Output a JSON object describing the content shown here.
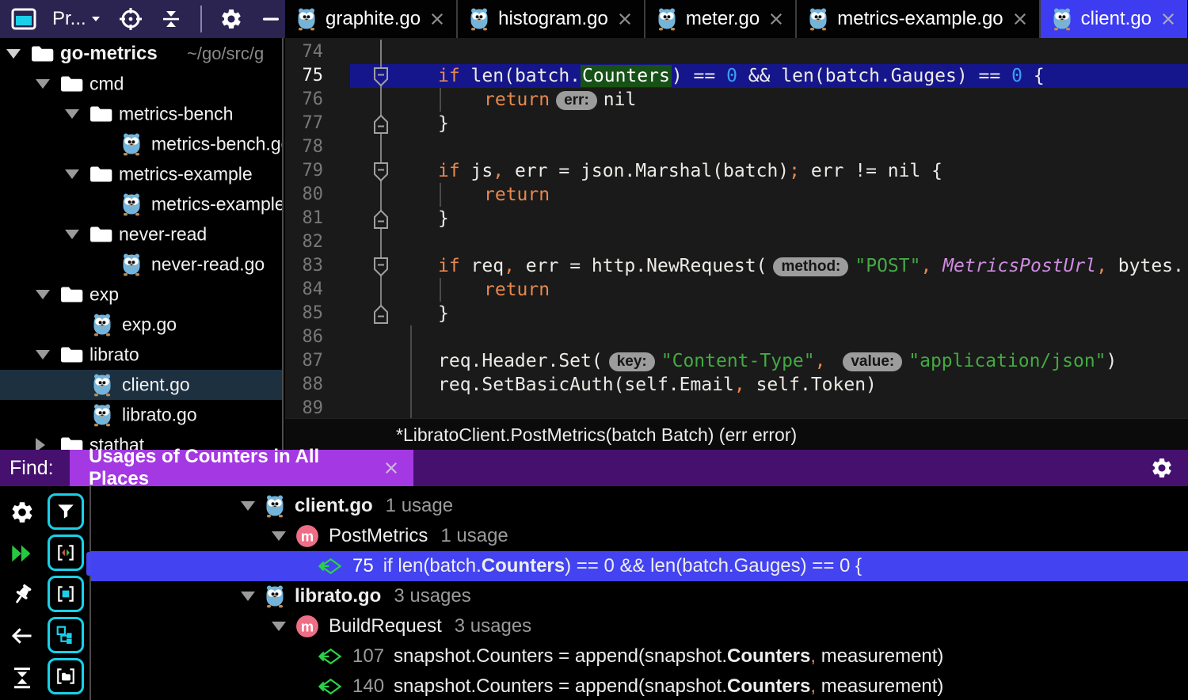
{
  "toolbar": {
    "project_label": "Pr...",
    "buttons": [
      {
        "name": "tool-window-button",
        "icon": "tool-window-icon"
      },
      {
        "name": "project-selector",
        "icon": "chevron-down-icon",
        "has_label": true
      },
      {
        "name": "locate-button",
        "icon": "target-icon"
      },
      {
        "name": "collapse-button",
        "icon": "collapse-icon"
      },
      {
        "name": "divider"
      },
      {
        "name": "settings-button",
        "icon": "gear-icon"
      },
      {
        "name": "hide-button",
        "icon": "minus-icon"
      }
    ]
  },
  "tabs": {
    "items": [
      {
        "label": "graphite.go"
      },
      {
        "label": "histogram.go"
      },
      {
        "label": "meter.go"
      },
      {
        "label": "metrics-example.go"
      },
      {
        "label": "client.go",
        "active": true
      }
    ]
  },
  "project_tree": {
    "items": [
      {
        "label": "go-metrics",
        "suffix": "~/go/src/g",
        "type": "folder",
        "depth": 0,
        "arrow": "down",
        "bold": true
      },
      {
        "label": "cmd",
        "type": "folder",
        "depth": 1,
        "arrow": "down"
      },
      {
        "label": "metrics-bench",
        "type": "folder",
        "depth": 2,
        "arrow": "down"
      },
      {
        "label": "metrics-bench.go",
        "type": "go-file",
        "depth": 3
      },
      {
        "label": "metrics-example",
        "type": "folder",
        "depth": 2,
        "arrow": "down"
      },
      {
        "label": "metrics-example.go",
        "type": "go-file",
        "depth": 3
      },
      {
        "label": "never-read",
        "type": "folder",
        "depth": 2,
        "arrow": "down"
      },
      {
        "label": "never-read.go",
        "type": "go-file",
        "depth": 3
      },
      {
        "label": "exp",
        "type": "folder",
        "depth": 1,
        "arrow": "down"
      },
      {
        "label": "exp.go",
        "type": "go-file",
        "depth": 2
      },
      {
        "label": "librato",
        "type": "folder",
        "depth": 1,
        "arrow": "down"
      },
      {
        "label": "client.go",
        "type": "go-file",
        "depth": 2,
        "selected": true
      },
      {
        "label": "librato.go",
        "type": "go-file",
        "depth": 2
      },
      {
        "label": "stathat",
        "type": "folder",
        "depth": 1,
        "arrow": "right"
      }
    ]
  },
  "editor": {
    "breadcrumb": "*LibratoClient.PostMetrics(batch Batch) (err error)",
    "lines": [
      {
        "num": 74,
        "ind": 0,
        "tok": []
      },
      {
        "num": 75,
        "ind": 1,
        "current": true,
        "fold": "start",
        "tok": [
          [
            "k",
            "if"
          ],
          [
            "p",
            " len(batch."
          ],
          [
            "m",
            "Counters"
          ],
          [
            "p",
            ") == "
          ],
          [
            "n",
            "0"
          ],
          [
            "p",
            " && len(batch.Gauges) == "
          ],
          [
            "n",
            "0"
          ],
          [
            "p",
            " {"
          ]
        ]
      },
      {
        "num": 76,
        "ind": 2,
        "guide": true,
        "tok": [
          [
            "k",
            "return"
          ],
          [
            "i",
            "err:"
          ],
          [
            "p",
            "nil"
          ]
        ]
      },
      {
        "num": 77,
        "ind": 1,
        "fold": "end",
        "tok": [
          [
            "p",
            "}"
          ]
        ]
      },
      {
        "num": 78,
        "ind": 0,
        "tok": []
      },
      {
        "num": 79,
        "ind": 1,
        "fold": "start",
        "tok": [
          [
            "k",
            "if"
          ],
          [
            "p",
            " js"
          ],
          [
            "o",
            ","
          ],
          [
            "p",
            " err = json.Marshal(batch)"
          ],
          [
            "o",
            ";"
          ],
          [
            "p",
            " err != nil {"
          ]
        ]
      },
      {
        "num": 80,
        "ind": 2,
        "guide": true,
        "tok": [
          [
            "k",
            "return"
          ]
        ]
      },
      {
        "num": 81,
        "ind": 1,
        "fold": "end",
        "tok": [
          [
            "p",
            "}"
          ]
        ]
      },
      {
        "num": 82,
        "ind": 0,
        "tok": []
      },
      {
        "num": 83,
        "ind": 1,
        "fold": "start",
        "tok": [
          [
            "k",
            "if"
          ],
          [
            "p",
            " req"
          ],
          [
            "o",
            ","
          ],
          [
            "p",
            " err = http.NewRequest("
          ],
          [
            "i",
            "method:"
          ],
          [
            "s",
            "\"POST\""
          ],
          [
            "o",
            ","
          ],
          [
            "p",
            " "
          ],
          [
            "t",
            "MetricsPostUrl"
          ],
          [
            "o",
            ","
          ],
          [
            "p",
            " bytes."
          ]
        ]
      },
      {
        "num": 84,
        "ind": 2,
        "guide": true,
        "tok": [
          [
            "k",
            "return"
          ]
        ]
      },
      {
        "num": 85,
        "ind": 1,
        "fold": "end",
        "tok": [
          [
            "p",
            "}"
          ]
        ]
      },
      {
        "num": 86,
        "ind": 0,
        "tok": []
      },
      {
        "num": 87,
        "ind": 1,
        "tok": [
          [
            "p",
            "req.Header.Set("
          ],
          [
            "i",
            "key:"
          ],
          [
            "s",
            "\"Content-Type\""
          ],
          [
            "o",
            ","
          ],
          [
            "p",
            " "
          ],
          [
            "i",
            "value:"
          ],
          [
            "s",
            "\"application/json\""
          ],
          [
            "p",
            ")"
          ]
        ]
      },
      {
        "num": 88,
        "ind": 1,
        "tok": [
          [
            "p",
            "req.SetBasicAuth(self.Email"
          ],
          [
            "o",
            ","
          ],
          [
            "p",
            " self.Token)"
          ]
        ]
      },
      {
        "num": 89,
        "ind": 0,
        "tok": []
      }
    ]
  },
  "find_bar": {
    "label": "Find:",
    "tab_title": "Usages of Counters in All Places"
  },
  "find_panel": {
    "toolbar_left": [
      "settings-icon",
      "rerun-icon",
      "pin-icon",
      "back-arrow-icon",
      "collapse-expand-icon"
    ],
    "toolbar_toggles": [
      "filter-icon",
      "read-write-access-icon",
      "preview-square-icon",
      "group-by-icon",
      "open-in-window-icon"
    ],
    "results": [
      {
        "kind": "file",
        "depth": 0,
        "label": "client.go",
        "count": "1 usage"
      },
      {
        "kind": "method",
        "depth": 1,
        "label": "PostMetrics",
        "count": "1 usage"
      },
      {
        "kind": "usage",
        "depth": 2,
        "line": "75",
        "selected": true,
        "segments": [
          {
            "text": "if len(batch."
          },
          {
            "text": "Counters",
            "bold": true
          },
          {
            "text": ") == 0 && len(batch.Gauges) == 0 {"
          }
        ]
      },
      {
        "kind": "file",
        "depth": 0,
        "label": "librato.go",
        "count": "3 usages"
      },
      {
        "kind": "method",
        "depth": 1,
        "label": "BuildRequest",
        "count": "3 usages"
      },
      {
        "kind": "usage",
        "depth": 2,
        "line": "107",
        "segments": [
          {
            "text": "snapshot.Counters = append(snapshot."
          },
          {
            "text": "Counters",
            "bold": true
          },
          {
            "text": ",",
            "orange": true
          },
          {
            "text": " measurement)"
          }
        ]
      },
      {
        "kind": "usage",
        "depth": 2,
        "line": "140",
        "segments": [
          {
            "text": "snapshot.Counters = append(snapshot."
          },
          {
            "text": "Counters",
            "bold": true
          },
          {
            "text": ",",
            "orange": true
          },
          {
            "text": " measurement)"
          }
        ]
      }
    ]
  },
  "colors": {
    "toolbar_purple": "#2b2350",
    "accent_tab_blue": "#3d3cf0",
    "selection_blue": "#4343f2",
    "current_line_blue": "#16168c",
    "match_green": "#175117",
    "keyword_orange": "#e8884e",
    "string_green": "#43aa43",
    "number_blue": "#3aa0f0",
    "type_purple": "#cf8ce0",
    "find_bar_purple": "#45106e",
    "find_tab_purple": "#a438e2",
    "panel_cyan": "#19d0e8",
    "usage_green": "#2bd14a",
    "method_pink": "#ee6e85",
    "gopher_blue": "#74b4da",
    "tree_selection": "#1c3040",
    "editor_bg": "#1a1a1a"
  }
}
